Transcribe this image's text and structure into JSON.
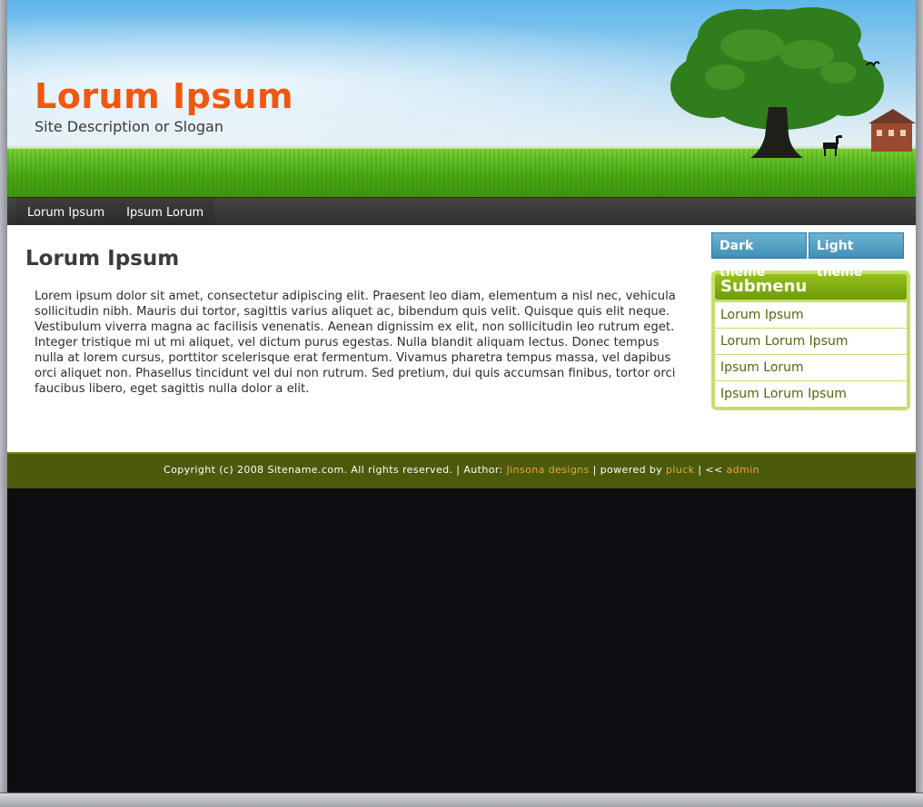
{
  "header": {
    "site_title": "Lorum Ipsum",
    "slogan": "Site Description or Slogan"
  },
  "nav": {
    "items": [
      {
        "label": "Lorum Ipsum"
      },
      {
        "label": "Ipsum Lorum"
      }
    ]
  },
  "main": {
    "heading": "Lorum Ipsum",
    "body": "Lorem ipsum dolor sit amet, consectetur adipiscing elit. Praesent leo diam, elementum a nisl nec, vehicula sollicitudin nibh. Mauris dui tortor, sagittis varius aliquet ac, bibendum quis velit. Quisque quis elit neque. Vestibulum viverra magna ac facilisis venenatis. Aenean dignissim ex elit, non sollicitudin leo rutrum eget. Integer tristique mi ut mi aliquet, vel dictum purus egestas. Nulla blandit aliquam lectus. Donec tempus nulla at lorem cursus, porttitor scelerisque erat fermentum. Vivamus pharetra tempus massa, vel dapibus orci aliquet non. Phasellus tincidunt vel dui non rutrum. Sed pretium, dui quis accumsan finibus, tortor orci faucibus libero, eget sagittis nulla dolor a elit."
  },
  "sidebar": {
    "dark_theme_label": "Dark theme",
    "light_theme_label": "Light theme",
    "submenu_title": "Submenu",
    "submenu_items": [
      {
        "label": "Lorum Ipsum"
      },
      {
        "label": "Lorum Lorum Ipsum"
      },
      {
        "label": "Ipsum Lorum"
      },
      {
        "label": "Ipsum Lorum Ipsum"
      }
    ]
  },
  "footer": {
    "copyright": "Copyright (c) 2008 Sitename.com. All rights reserved.",
    "sep1": " | ",
    "author_prefix": "Author: ",
    "author_link": "Jinsona designs",
    "sep2": " | ",
    "powered_prefix": "powered by ",
    "powered_link": "pluck",
    "sep3": " | ",
    "admin_prefix": "<< ",
    "admin_link": "admin"
  },
  "colors": {
    "title_orange": "#f0570f",
    "nav_bg": "#363636",
    "theme_button_blue": "#4e9dc2",
    "submenu_green": "#7fa812",
    "footer_olive": "#4c5a0c",
    "footer_link": "#e6a63a",
    "page_bg": "#0d0e11"
  },
  "icons": {
    "header_illustration": "tree-landscape"
  }
}
